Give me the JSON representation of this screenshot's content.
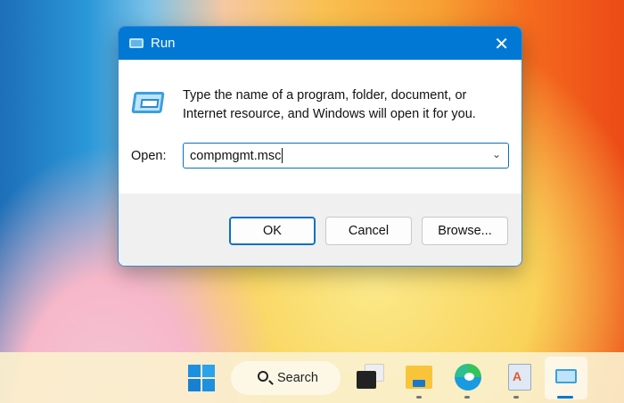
{
  "dialog": {
    "title": "Run",
    "description_line1": "Type the name of a program, folder, document, or",
    "description_line2": "Internet resource, and Windows will open it for you.",
    "open_label": "Open:",
    "open_value": "compmgmt.msc",
    "ok": "OK",
    "cancel": "Cancel",
    "browse": "Browse..."
  },
  "taskbar": {
    "search_label": "Search",
    "items": [
      "start",
      "task-view",
      "file-explorer",
      "microsoft-edge",
      "wordpad",
      "run"
    ],
    "accent": "#0078d4"
  }
}
